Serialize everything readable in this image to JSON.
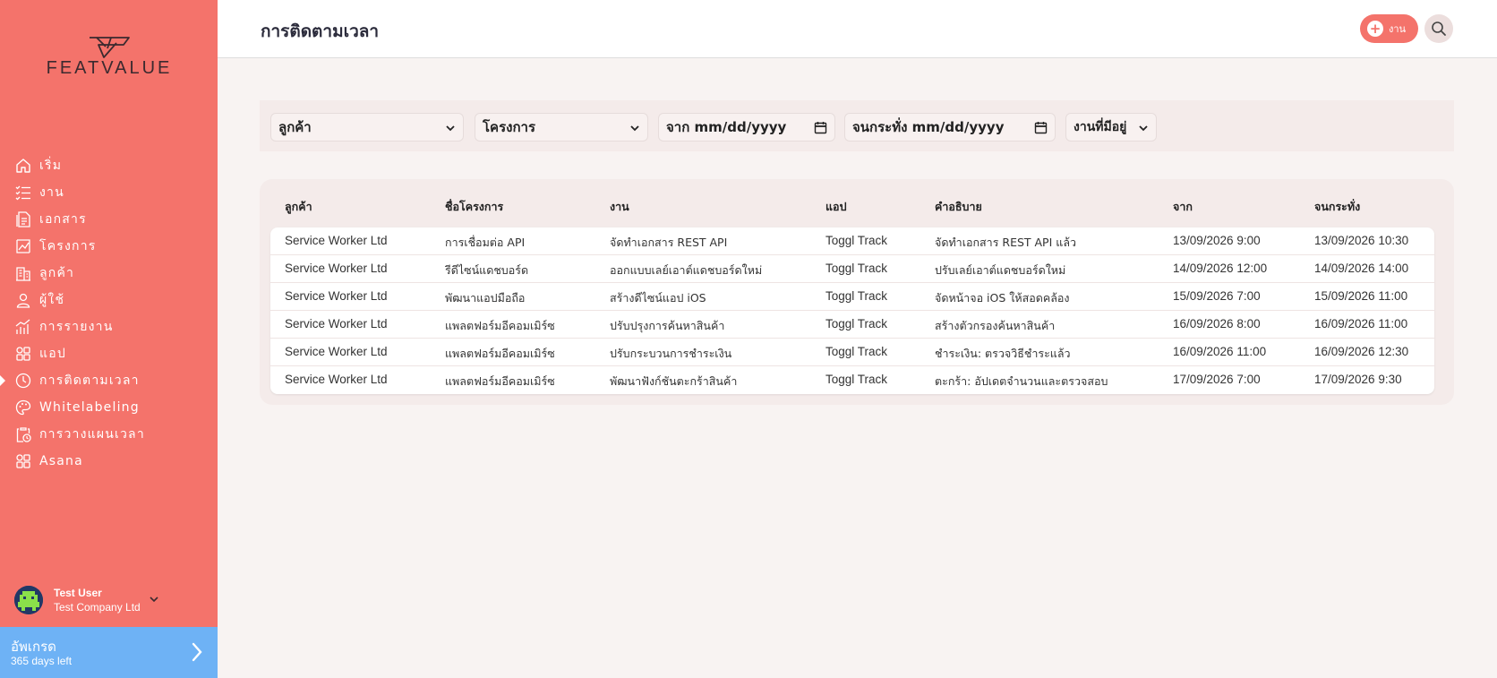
{
  "brand": {
    "logo_text": "FEATVALUE"
  },
  "sidebar": {
    "items": [
      {
        "label": "เริ่ม",
        "icon": "home-icon"
      },
      {
        "label": "งาน",
        "icon": "tasks-icon"
      },
      {
        "label": "เอกสาร",
        "icon": "documents-icon"
      },
      {
        "label": "โครงการ",
        "icon": "projects-icon"
      },
      {
        "label": "ลูกค้า",
        "icon": "clients-icon"
      },
      {
        "label": "ผู้ใช้",
        "icon": "user-icon"
      },
      {
        "label": "การรายงาน",
        "icon": "reports-icon"
      },
      {
        "label": "แอป",
        "icon": "apps-icon"
      },
      {
        "label": "การติดตามเวลา",
        "icon": "clock-icon",
        "active": true
      },
      {
        "label": "Whitelabeling",
        "icon": "palette-icon"
      },
      {
        "label": "การวางแผนเวลา",
        "icon": "clipboard-clock-icon"
      },
      {
        "label": "Asana",
        "icon": "apps-icon"
      }
    ],
    "user": {
      "name": "Test User",
      "company": "Test Company Ltd"
    },
    "upgrade": {
      "title": "อัพเกรด",
      "subtitle": "365 days left"
    }
  },
  "header": {
    "title": "การติดตามเวลา",
    "add_label": "งาน"
  },
  "filters": {
    "client": "ลูกค้า",
    "project": "โครงการ",
    "from": "จาก mm/dd/yyyy",
    "until": "จนกระทั่ง mm/dd/yyyy",
    "status": "งานที่มีอยู่"
  },
  "table": {
    "headers": [
      "ลูกค้า",
      "ชื่อโครงการ",
      "งาน",
      "แอป",
      "คำอธิบาย",
      "จาก",
      "จนกระทั่ง"
    ],
    "rows": [
      [
        "Service Worker Ltd",
        "การเชื่อมต่อ API",
        "จัดทำเอกสาร REST API",
        "Toggl Track",
        "จัดทำเอกสาร REST API แล้ว",
        "13/09/2026 9:00",
        "13/09/2026 10:30"
      ],
      [
        "Service Worker Ltd",
        "รีดีไซน์แดชบอร์ด",
        "ออกแบบเลย์เอาต์แดชบอร์ดใหม่",
        "Toggl Track",
        "ปรับเลย์เอาต์แดชบอร์ดใหม่",
        "14/09/2026 12:00",
        "14/09/2026 14:00"
      ],
      [
        "Service Worker Ltd",
        "พัฒนาแอปมือถือ",
        "สร้างดีไซน์แอป iOS",
        "Toggl Track",
        "จัดหน้าจอ iOS ให้สอดคล้อง",
        "15/09/2026 7:00",
        "15/09/2026 11:00"
      ],
      [
        "Service Worker Ltd",
        "แพลตฟอร์มอีคอมเมิร์ซ",
        "ปรับปรุงการค้นหาสินค้า",
        "Toggl Track",
        "สร้างตัวกรองค้นหาสินค้า",
        "16/09/2026 8:00",
        "16/09/2026 11:00"
      ],
      [
        "Service Worker Ltd",
        "แพลตฟอร์มอีคอมเมิร์ซ",
        "ปรับกระบวนการชำระเงิน",
        "Toggl Track",
        "ชำระเงิน: ตรวจวิธีชำระแล้ว",
        "16/09/2026 11:00",
        "16/09/2026 12:30"
      ],
      [
        "Service Worker Ltd",
        "แพลตฟอร์มอีคอมเมิร์ซ",
        "พัฒนาฟังก์ชันตะกร้าสินค้า",
        "Toggl Track",
        "ตะกร้า: อัปเดตจำนวนและตรวจสอบ",
        "17/09/2026 7:00",
        "17/09/2026 9:30"
      ]
    ]
  },
  "colors": {
    "accent": "#f4736b",
    "upgrade": "#6eb2f5"
  }
}
